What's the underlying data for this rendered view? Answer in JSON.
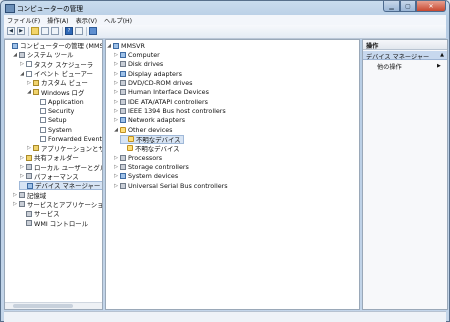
{
  "window": {
    "title": "コンピューターの管理"
  },
  "menu": [
    "ファイル(F)",
    "操作(A)",
    "表示(V)",
    "ヘルプ(H)"
  ],
  "left_tree": [
    {
      "label": "コンピューターの管理 (MMSVR)",
      "indent": 0,
      "exp": "",
      "icon": "pc"
    },
    {
      "label": "システム ツール",
      "indent": 1,
      "exp": "◢",
      "icon": "gray"
    },
    {
      "label": "タスク スケジューラ",
      "indent": 2,
      "exp": "▷",
      "icon": "log"
    },
    {
      "label": "イベント ビューアー",
      "indent": 2,
      "exp": "◢",
      "icon": "log"
    },
    {
      "label": "カスタム ビュー",
      "indent": 3,
      "exp": "▷",
      "icon": "yellow"
    },
    {
      "label": "Windows ログ",
      "indent": 3,
      "exp": "◢",
      "icon": "yellow"
    },
    {
      "label": "Application",
      "indent": 4,
      "exp": "",
      "icon": "log"
    },
    {
      "label": "Security",
      "indent": 4,
      "exp": "",
      "icon": "log"
    },
    {
      "label": "Setup",
      "indent": 4,
      "exp": "",
      "icon": "log"
    },
    {
      "label": "System",
      "indent": 4,
      "exp": "",
      "icon": "log"
    },
    {
      "label": "Forwarded Events",
      "indent": 4,
      "exp": "",
      "icon": "log"
    },
    {
      "label": "アプリケーションとサー",
      "indent": 3,
      "exp": "▷",
      "icon": "yellow"
    },
    {
      "label": "共有フォルダー",
      "indent": 2,
      "exp": "▷",
      "icon": "yellow"
    },
    {
      "label": "ローカル ユーザーとグルー",
      "indent": 2,
      "exp": "▷",
      "icon": "gray"
    },
    {
      "label": "パフォーマンス",
      "indent": 2,
      "exp": "▷",
      "icon": "gray"
    },
    {
      "label": "デバイス マネージャー",
      "indent": 2,
      "exp": "",
      "icon": "pc",
      "selected": true
    },
    {
      "label": "記憶域",
      "indent": 1,
      "exp": "▷",
      "icon": "gray"
    },
    {
      "label": "サービスとアプリケーション",
      "indent": 1,
      "exp": "▷",
      "icon": "gray"
    },
    {
      "label": "サービス",
      "indent": 2,
      "exp": "",
      "icon": "gray"
    },
    {
      "label": "WMI コントロール",
      "indent": 2,
      "exp": "",
      "icon": "gray"
    }
  ],
  "device_tree": [
    {
      "label": "MMSVR",
      "indent": 0,
      "exp": "◢",
      "icon": "pc"
    },
    {
      "label": "Computer",
      "indent": 1,
      "exp": "▷",
      "icon": "pc"
    },
    {
      "label": "Disk drives",
      "indent": 1,
      "exp": "▷",
      "icon": "gray"
    },
    {
      "label": "Display adapters",
      "indent": 1,
      "exp": "▷",
      "icon": "pc"
    },
    {
      "label": "DVD/CD-ROM drives",
      "indent": 1,
      "exp": "▷",
      "icon": "gray"
    },
    {
      "label": "Human Interface Devices",
      "indent": 1,
      "exp": "▷",
      "icon": "gray"
    },
    {
      "label": "IDE ATA/ATAPI controllers",
      "indent": 1,
      "exp": "▷",
      "icon": "gray"
    },
    {
      "label": "IEEE 1394 Bus host controllers",
      "indent": 1,
      "exp": "▷",
      "icon": "gray"
    },
    {
      "label": "Network adapters",
      "indent": 1,
      "exp": "▷",
      "icon": "pc"
    },
    {
      "label": "Other devices",
      "indent": 1,
      "exp": "◢",
      "icon": "warn"
    },
    {
      "label": "不明なデバイス",
      "indent": 2,
      "exp": "",
      "icon": "warn",
      "selected": true
    },
    {
      "label": "不明なデバイス",
      "indent": 2,
      "exp": "",
      "icon": "warn"
    },
    {
      "label": "Processors",
      "indent": 1,
      "exp": "▷",
      "icon": "gray"
    },
    {
      "label": "Storage controllers",
      "indent": 1,
      "exp": "▷",
      "icon": "gray"
    },
    {
      "label": "System devices",
      "indent": 1,
      "exp": "▷",
      "icon": "pc"
    },
    {
      "label": "Universal Serial Bus controllers",
      "indent": 1,
      "exp": "▷",
      "icon": "gray"
    }
  ],
  "actions": {
    "header": "操作",
    "section": "デバイス マネージャー",
    "section_arrow": "▲",
    "item": "他の操作",
    "item_arrow": "▶"
  }
}
